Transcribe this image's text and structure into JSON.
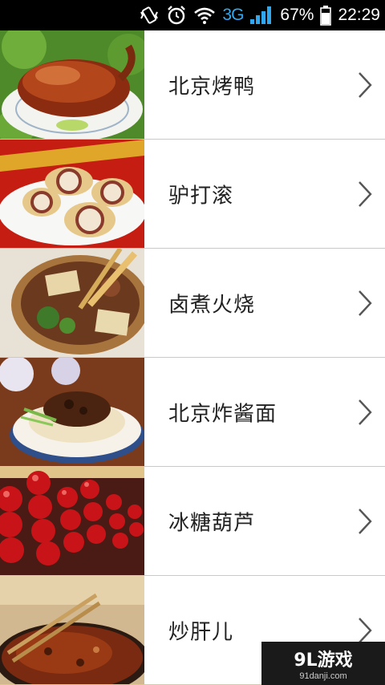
{
  "status_bar": {
    "network": "3G",
    "battery": "67%",
    "time": "22:29"
  },
  "foods": [
    {
      "name": "北京烤鸭",
      "image": "roast-duck"
    },
    {
      "name": "驴打滚",
      "image": "donkey-roll"
    },
    {
      "name": "卤煮火烧",
      "image": "luzhu-stew"
    },
    {
      "name": "北京炸酱面",
      "image": "zhajiang-noodles"
    },
    {
      "name": "冰糖葫芦",
      "image": "candied-haws"
    },
    {
      "name": "炒肝儿",
      "image": "fried-liver"
    }
  ],
  "watermark": {
    "main": "9L游戏",
    "sub": "91danji.com"
  }
}
